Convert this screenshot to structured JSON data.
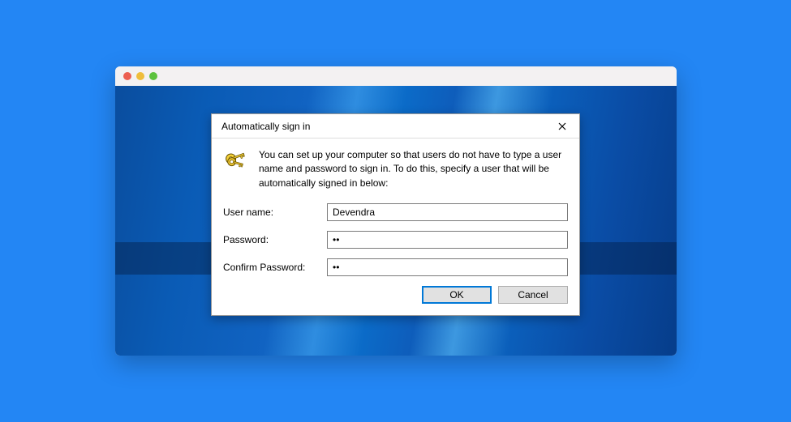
{
  "dialog": {
    "title": "Automatically sign in",
    "description": "You can set up your computer so that users do not have to type a user name and password to sign in. To do this, specify a user that will be automatically signed in below:",
    "fields": {
      "username": {
        "label": "User name:",
        "value": "Devendra"
      },
      "password": {
        "label": "Password:",
        "value": "••"
      },
      "confirm": {
        "label": "Confirm Password:",
        "value": "••"
      }
    },
    "buttons": {
      "ok": "OK",
      "cancel": "Cancel"
    }
  }
}
